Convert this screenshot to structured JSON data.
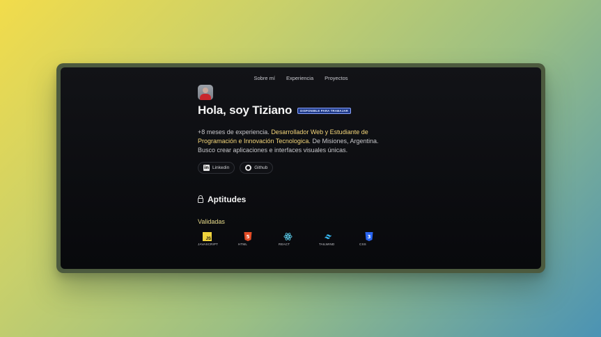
{
  "nav": [
    "Sobre mí",
    "Experiencia",
    "Proyectos"
  ],
  "header": {
    "title": "Hola, soy Tiziano",
    "badge": "DISPONIBLE PARA TRABAJAR"
  },
  "bio": {
    "part1": "+8 meses de experiencia. ",
    "highlight": "Desarrollador Web y Estudiante de Programación e Innovación Tecnologica.",
    "part2": " De Misiones, Argentina. Busco crear aplicaciones e interfaces visuales únicas."
  },
  "social": {
    "linkedin_label": "Linkedin",
    "github_label": "Github"
  },
  "skills": {
    "title": "Aptitudes",
    "subtitle": "Validadas",
    "items": [
      {
        "label": "JAVASCRIPT",
        "icon": "javascript-icon"
      },
      {
        "label": "HTML",
        "icon": "html-icon"
      },
      {
        "label": "REACT",
        "icon": "react-icon"
      },
      {
        "label": "TAILWIND",
        "icon": "tailwind-icon"
      },
      {
        "label": "CSS",
        "icon": "css-icon"
      }
    ]
  },
  "colors": {
    "highlight": "#f4d67a",
    "badge_bg": "#1e3a8a",
    "html": "#e34c26",
    "css": "#2965f1",
    "react": "#61dafb",
    "tailwind": "#38bdf8",
    "js": "#f0d33c"
  }
}
